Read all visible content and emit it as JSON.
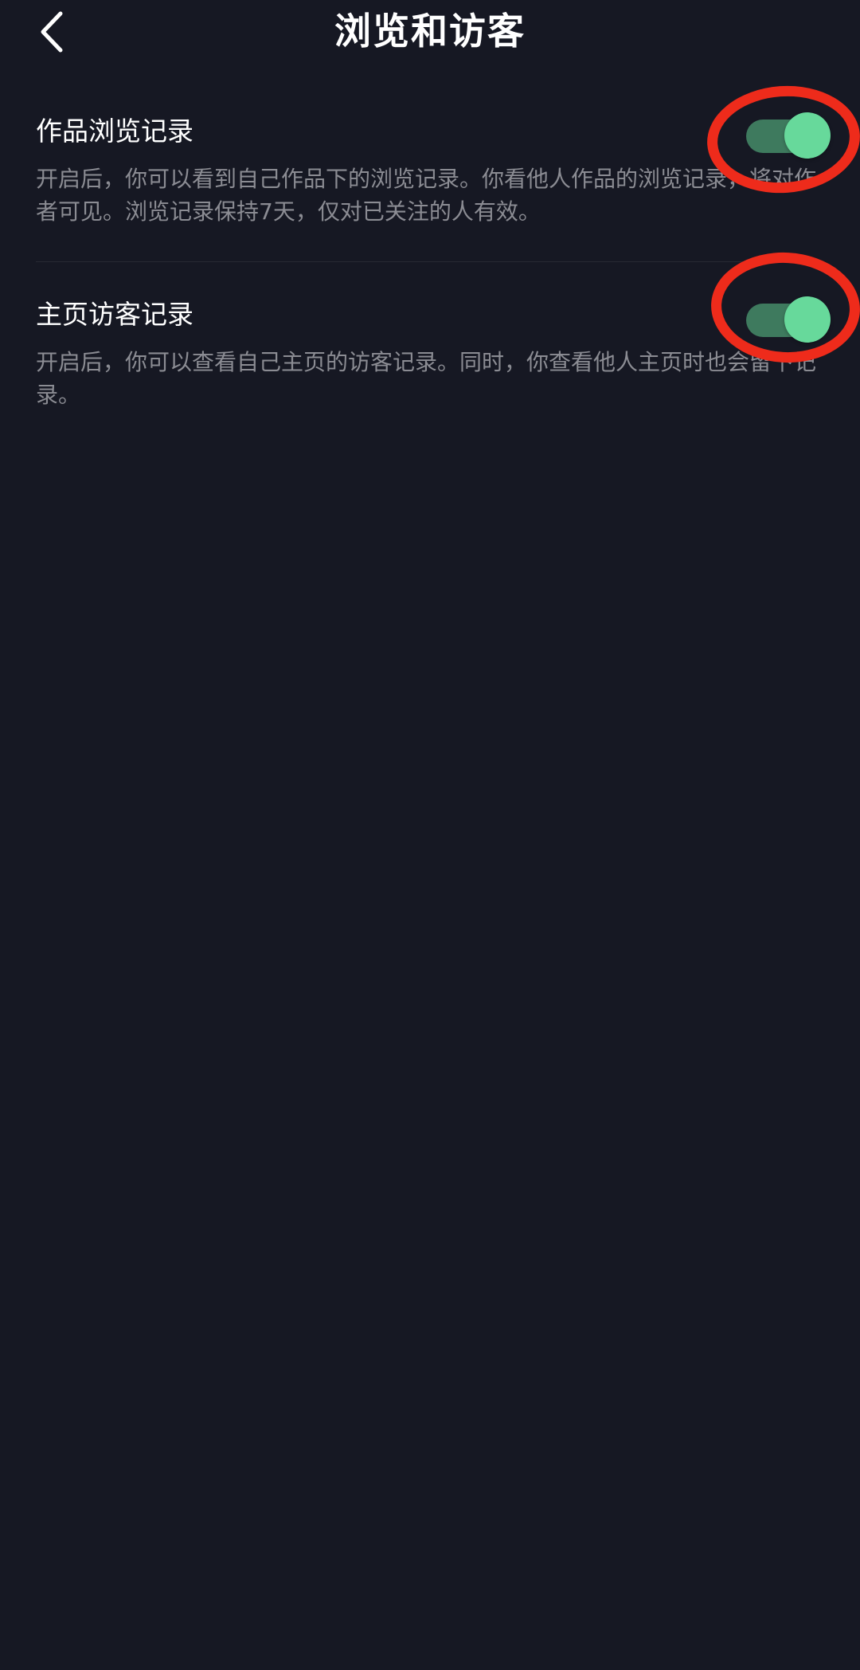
{
  "header": {
    "title": "浏览和访客",
    "back_icon": "chevron-left-icon"
  },
  "settings": [
    {
      "title": "作品浏览记录",
      "description": "开启后，你可以看到自己作品下的浏览记录。你看他人作品的浏览记录，将对作者可见。浏览记录保持7天，仅对已关注的人有效。",
      "enabled": true
    },
    {
      "title": "主页访客记录",
      "description": "开启后，你可以查看自己主页的访客记录。同时，你查看他人主页时也会留下记录。",
      "enabled": true
    }
  ],
  "colors": {
    "background": "#161823",
    "text_primary": "#ffffff",
    "text_secondary": "#8b8c93",
    "toggle_track_on": "#3e7a5e",
    "toggle_knob_on": "#67d99b",
    "annotation": "#ee2b1b"
  }
}
